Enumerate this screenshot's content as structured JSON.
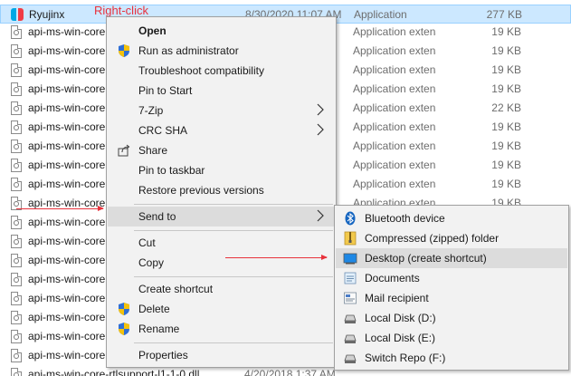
{
  "files": [
    {
      "name": "Ryujinx",
      "date": "8/30/2020 11:07 AM",
      "type": "Application",
      "size": "277 KB",
      "icon": "ryujinx-app-icon"
    },
    {
      "name": "api-ms-win-core",
      "type": "Application extens...",
      "size": "19 KB",
      "icon": "dll-file-icon"
    },
    {
      "name": "api-ms-win-core",
      "type": "Application extens...",
      "size": "19 KB",
      "icon": "dll-file-icon"
    },
    {
      "name": "api-ms-win-core",
      "type": "Application extens...",
      "size": "19 KB",
      "icon": "dll-file-icon"
    },
    {
      "name": "api-ms-win-core",
      "type": "Application extens...",
      "size": "19 KB",
      "icon": "dll-file-icon"
    },
    {
      "name": "api-ms-win-core",
      "type": "Application extens...",
      "size": "22 KB",
      "icon": "dll-file-icon"
    },
    {
      "name": "api-ms-win-core",
      "type": "Application extens...",
      "size": "19 KB",
      "icon": "dll-file-icon"
    },
    {
      "name": "api-ms-win-core",
      "type": "Application extens...",
      "size": "19 KB",
      "icon": "dll-file-icon"
    },
    {
      "name": "api-ms-win-core",
      "type": "Application extens...",
      "size": "19 KB",
      "icon": "dll-file-icon"
    },
    {
      "name": "api-ms-win-core",
      "type": "Application extens...",
      "size": "19 KB",
      "icon": "dll-file-icon"
    },
    {
      "name": "api-ms-win-core",
      "type": "Application extens...",
      "size": "19 KB",
      "icon": "dll-file-icon"
    },
    {
      "name": "api-ms-win-core",
      "type": "",
      "size": "",
      "icon": "dll-file-icon"
    },
    {
      "name": "api-ms-win-core",
      "type": "",
      "size": "",
      "icon": "dll-file-icon"
    },
    {
      "name": "api-ms-win-core",
      "type": "",
      "size": "",
      "icon": "dll-file-icon"
    },
    {
      "name": "api-ms-win-core",
      "type": "",
      "size": "",
      "icon": "dll-file-icon"
    },
    {
      "name": "api-ms-win-core",
      "type": "",
      "size": "",
      "icon": "dll-file-icon"
    },
    {
      "name": "api-ms-win-core",
      "type": "",
      "size": "",
      "icon": "dll-file-icon"
    },
    {
      "name": "api-ms-win-core",
      "type": "",
      "size": "",
      "icon": "dll-file-icon"
    },
    {
      "name": "api-ms-win-core",
      "type": "",
      "size": "",
      "icon": "dll-file-icon"
    },
    {
      "name": "api-ms-win-core-rtlsupport-l1-1-0.dll",
      "date": "4/20/2018 1:37 AM",
      "type": "",
      "size": "",
      "icon": "dll-file-icon"
    }
  ],
  "annotation": {
    "label": "Right-click",
    "color": "#e8323c"
  },
  "context_menu": {
    "items": [
      {
        "label": "Open",
        "bold": true,
        "icon": ""
      },
      {
        "label": "Run as administrator",
        "icon": "uac-shield-icon"
      },
      {
        "label": "Troubleshoot compatibility",
        "icon": ""
      },
      {
        "label": "Pin to Start",
        "icon": ""
      },
      {
        "label": "7-Zip",
        "icon": "",
        "submenu": true
      },
      {
        "label": "CRC SHA",
        "icon": "",
        "submenu": true
      },
      {
        "label": "Share",
        "icon": "share-icon"
      },
      {
        "label": "Pin to taskbar",
        "icon": ""
      },
      {
        "label": "Restore previous versions",
        "icon": ""
      },
      {
        "label": "Send to",
        "icon": "",
        "submenu": true,
        "active": true
      },
      {
        "label": "Cut",
        "icon": ""
      },
      {
        "label": "Copy",
        "icon": ""
      },
      {
        "label": "Create shortcut",
        "icon": ""
      },
      {
        "label": "Delete",
        "icon": "uac-shield-icon"
      },
      {
        "label": "Rename",
        "icon": "uac-shield-icon"
      },
      {
        "label": "Properties",
        "icon": ""
      }
    ]
  },
  "send_to_menu": {
    "items": [
      {
        "label": "Bluetooth device",
        "icon": "bluetooth-icon"
      },
      {
        "label": "Compressed (zipped) folder",
        "icon": "zip-folder-icon"
      },
      {
        "label": "Desktop (create shortcut)",
        "icon": "desktop-icon",
        "active": true
      },
      {
        "label": "Documents",
        "icon": "documents-icon"
      },
      {
        "label": "Mail recipient",
        "icon": "mail-icon"
      },
      {
        "label": "Local Disk (D:)",
        "icon": "drive-icon"
      },
      {
        "label": "Local Disk (E:)",
        "icon": "drive-icon"
      },
      {
        "label": "Switch Repo (F:)",
        "icon": "drive-icon"
      }
    ]
  },
  "colors": {
    "selection": "#cce8ff",
    "menu_bg": "#f2f2f2",
    "menu_hover": "#dcdcdc",
    "accent_red": "#e8323c"
  }
}
